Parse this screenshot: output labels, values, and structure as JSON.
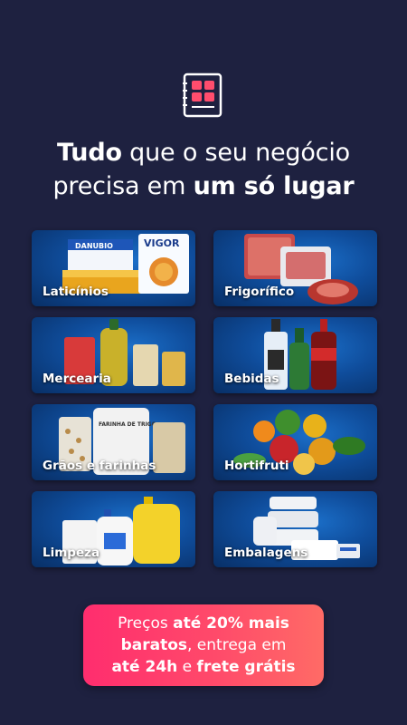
{
  "headline": {
    "line1_bold": "Tudo",
    "line1_rest": " que o seu negócio",
    "line2_rest": "precisa em ",
    "line2_bold": "um só lugar"
  },
  "categories": [
    {
      "label": "Laticínios"
    },
    {
      "label": "Frigorífico"
    },
    {
      "label": "Mercearia"
    },
    {
      "label": "Bebidas"
    },
    {
      "label": "Grãos e farinhas"
    },
    {
      "label": "Hortifruti"
    },
    {
      "label": "Limpeza"
    },
    {
      "label": "Embalagens"
    }
  ],
  "product_texts": {
    "danubio": "DANUBIO",
    "vigor": "VIGOR",
    "farinha": "FARINHA DE TRIGO"
  },
  "promo": {
    "part1": "Preços ",
    "part2_bold": "até 20% mais",
    "part3_bold": "baratos",
    "part4": ", entrega em",
    "part5_bold": "até 24h",
    "part6": " e ",
    "part7_bold": "frete grátis"
  },
  "colors": {
    "background": "#1e2140",
    "card": "#0f4d9c",
    "promo_start": "#ff2d6e",
    "promo_end": "#ff6b66",
    "logo_accent": "#ff4d6d"
  }
}
